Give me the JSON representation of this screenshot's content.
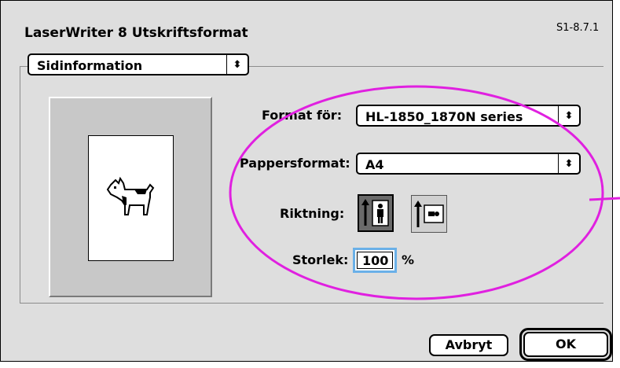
{
  "window": {
    "title": "LaserWriter 8 Utskriftsformat",
    "version": "S1-8.7.1"
  },
  "section_popup": {
    "value": "Sidinformation",
    "arrow_glyph": "⬍"
  },
  "form": {
    "format_for_label": "Format för:",
    "format_for_value": "HL-1850_1870N series",
    "paper_label": "Pappersformat:",
    "paper_value": "A4",
    "orientation_label": "Riktning:",
    "orientation_selected": "portrait",
    "scale_label": "Storlek:",
    "scale_value": "100",
    "scale_unit": "%"
  },
  "buttons": {
    "cancel": "Avbryt",
    "ok": "OK"
  },
  "colors": {
    "dialog_bg": "#dedede",
    "annotation": "#e020e0",
    "focus_ring": "#6ab0e8"
  }
}
